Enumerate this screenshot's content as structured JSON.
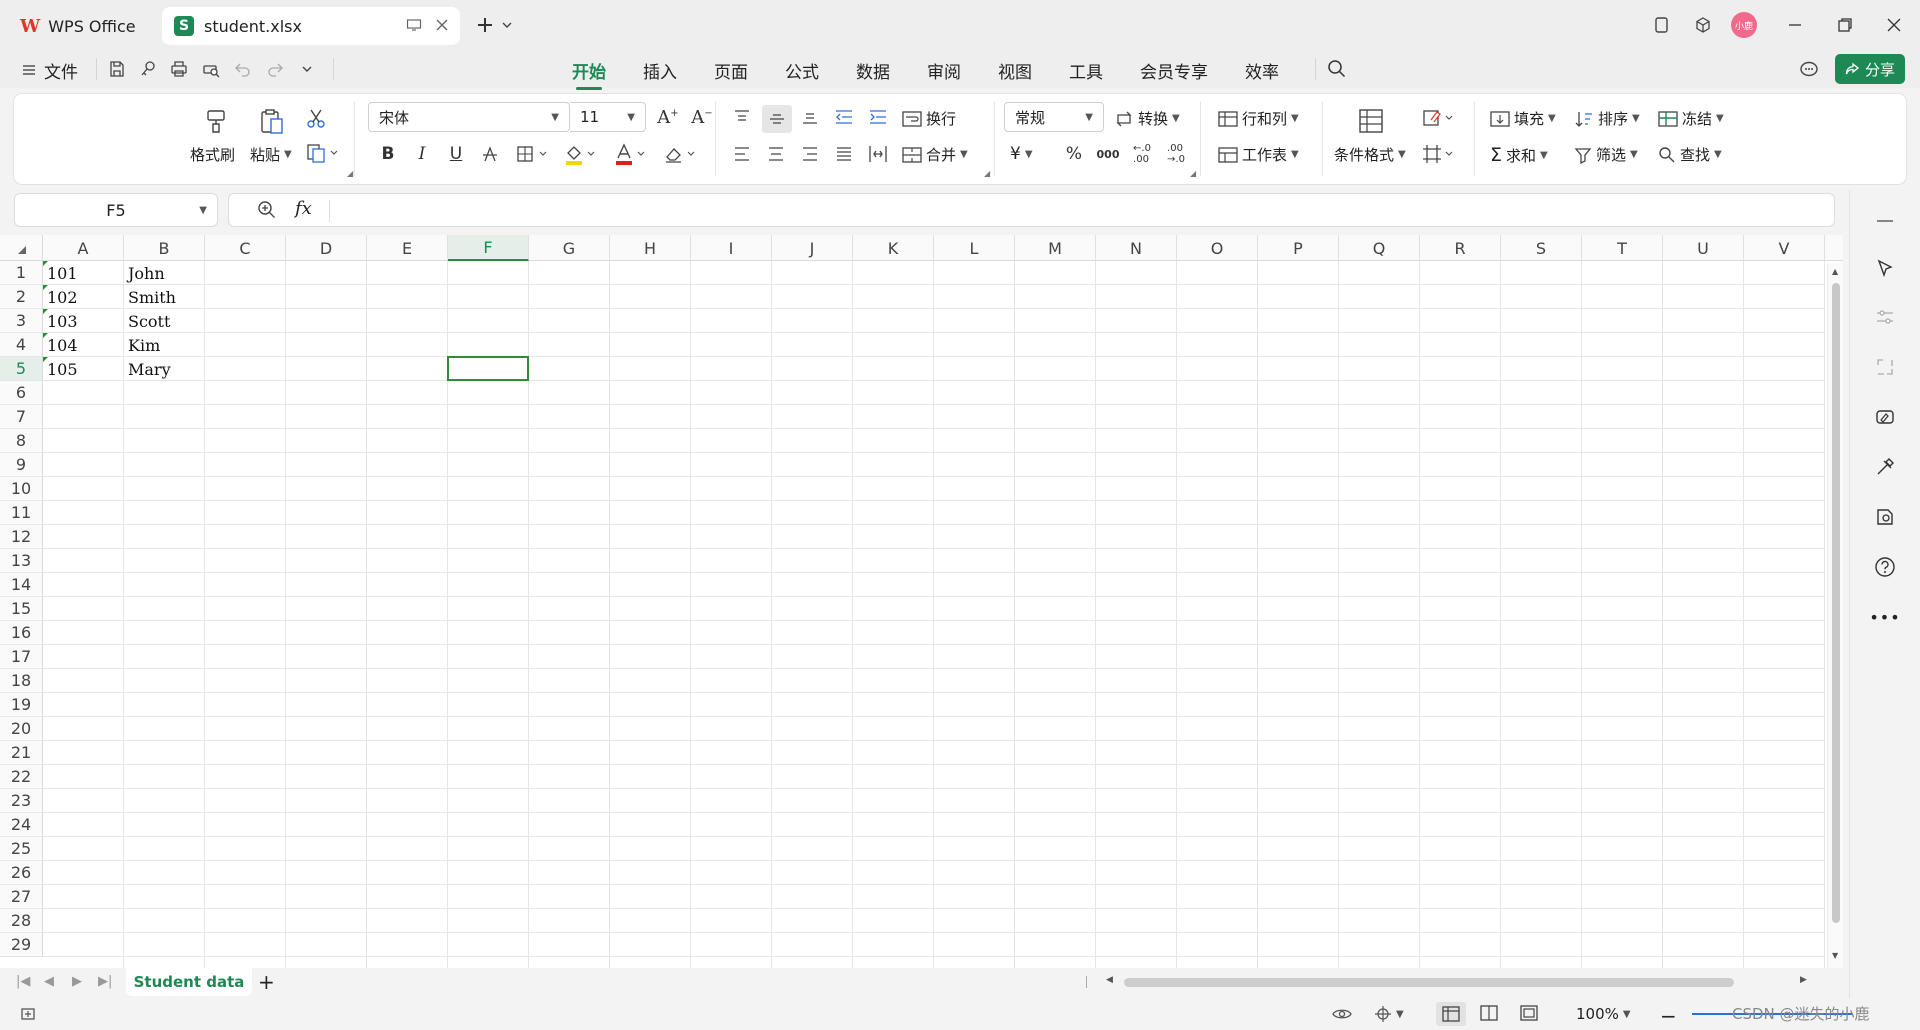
{
  "app": {
    "home_tab": "WPS Office",
    "file_tab": "student.xlsx",
    "avatar": "小鹿"
  },
  "menu": {
    "file": "文件",
    "tabs": [
      "开始",
      "插入",
      "页面",
      "公式",
      "数据",
      "审阅",
      "视图",
      "工具",
      "会员专享",
      "效率"
    ],
    "active_tab": "开始",
    "share": "分享"
  },
  "ribbon": {
    "format_painter": "格式刷",
    "paste": "粘贴",
    "font_name": "宋体",
    "font_size": "11",
    "wrap": "换行",
    "merge": "合并",
    "number_format": "常规",
    "convert": "转换",
    "rows_cols": "行和列",
    "worksheet": "工作表",
    "cond_format": "条件格式",
    "fill": "填充",
    "sort": "排序",
    "freeze": "冻结",
    "sum": "求和",
    "filter": "筛选",
    "find": "查找",
    "bold": "B",
    "italic": "I",
    "underline": "U",
    "currency": "¥",
    "percent": "%"
  },
  "formula_bar": {
    "name_box": "F5",
    "fx": "fx",
    "value": ""
  },
  "grid": {
    "columns": [
      "A",
      "B",
      "C",
      "D",
      "E",
      "F",
      "G",
      "H",
      "I",
      "J",
      "K",
      "L",
      "M",
      "N",
      "O",
      "P",
      "Q",
      "R",
      "S",
      "T",
      "U",
      "V"
    ],
    "selected_column": "F",
    "selected_row": "5",
    "row_count": 29,
    "rows": [
      {
        "A": "101",
        "B": "John"
      },
      {
        "A": "102",
        "B": "Smith"
      },
      {
        "A": "103",
        "B": "Scott"
      },
      {
        "A": "104",
        "B": "Kim"
      },
      {
        "A": "105",
        "B": "Mary"
      }
    ]
  },
  "sheets": {
    "active": "Student data",
    "add": "+"
  },
  "status": {
    "zoom": "100%",
    "watermark": "CSDN @迷失的小鹿"
  }
}
